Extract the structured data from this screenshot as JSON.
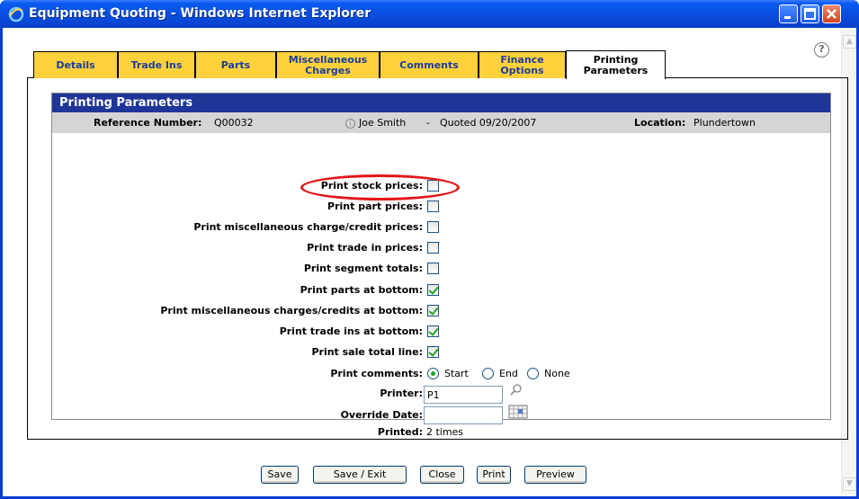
{
  "window": {
    "title": "Equipment Quoting - Windows Internet Explorer"
  },
  "tabs": [
    {
      "label": "Details"
    },
    {
      "label": "Trade Ins"
    },
    {
      "label": "Parts"
    },
    {
      "label": "Miscellaneous Charges"
    },
    {
      "label": "Comments"
    },
    {
      "label": "Finance Options"
    },
    {
      "label": "Printing Parameters"
    }
  ],
  "section": {
    "title": "Printing Parameters",
    "reference_label": "Reference Number:",
    "reference_value": "Q00032",
    "customer": "Joe Smith",
    "separator": "-",
    "quoted": "Quoted 09/20/2007",
    "location_label": "Location:",
    "location_value": "Plundertown"
  },
  "options": [
    {
      "label": "Print stock prices:",
      "checked": false
    },
    {
      "label": "Print part prices:",
      "checked": false
    },
    {
      "label": "Print miscellaneous charge/credit prices:",
      "checked": false
    },
    {
      "label": "Print trade in prices:",
      "checked": false
    },
    {
      "label": "Print segment totals:",
      "checked": false
    },
    {
      "label": "Print parts at bottom:",
      "checked": true
    },
    {
      "label": "Print miscellaneous charges/credits at bottom:",
      "checked": true
    },
    {
      "label": "Print trade ins at bottom:",
      "checked": true
    },
    {
      "label": "Print sale total line:",
      "checked": true
    }
  ],
  "comments": {
    "label": "Print comments:",
    "choices": [
      "Start",
      "End",
      "None"
    ],
    "selected": "Start"
  },
  "printer": {
    "label": "Printer:",
    "value": "P1"
  },
  "override_date": {
    "label": "Override Date:",
    "value": ""
  },
  "printed": {
    "label": "Printed:",
    "value": "2 times"
  },
  "buttons": {
    "save": "Save",
    "save_exit": "Save / Exit",
    "close": "Close",
    "print": "Print",
    "preview": "Preview"
  },
  "colors": {
    "tab": "#ffd13b",
    "section_header": "#1f3698",
    "highlight": "#e3151a",
    "check": "#21a121"
  }
}
